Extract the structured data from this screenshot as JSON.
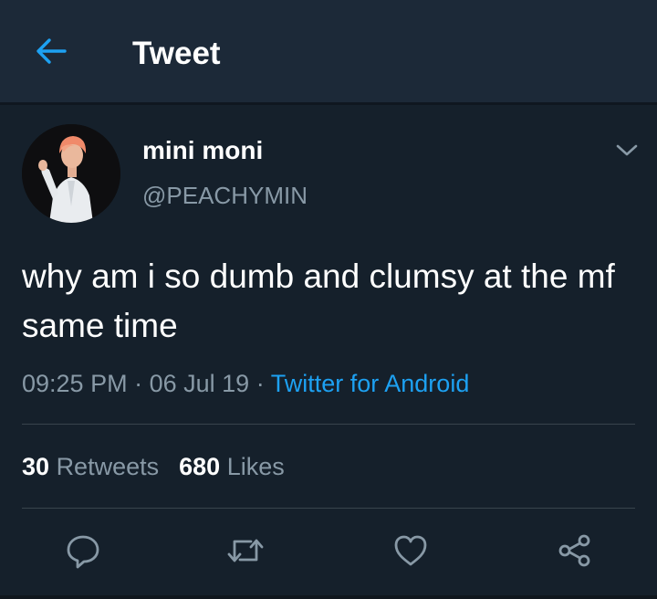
{
  "header": {
    "title": "Tweet",
    "back_icon": "arrow-left-icon",
    "accent_color": "#1da1f2"
  },
  "tweet": {
    "author": {
      "name": "mini moni",
      "handle": "@PEACHYMIN"
    },
    "text": "why am i so dumb and clumsy at the mf same time",
    "time": "09:25 PM",
    "date": "06 Jul 19",
    "separator": "·",
    "source": "Twitter for Android",
    "stats": {
      "retweets_count": "30",
      "retweets_label": "Retweets",
      "likes_count": "680",
      "likes_label": "Likes"
    }
  },
  "actions": [
    {
      "icon": "reply-icon"
    },
    {
      "icon": "retweet-icon"
    },
    {
      "icon": "heart-icon"
    },
    {
      "icon": "share-icon"
    }
  ]
}
